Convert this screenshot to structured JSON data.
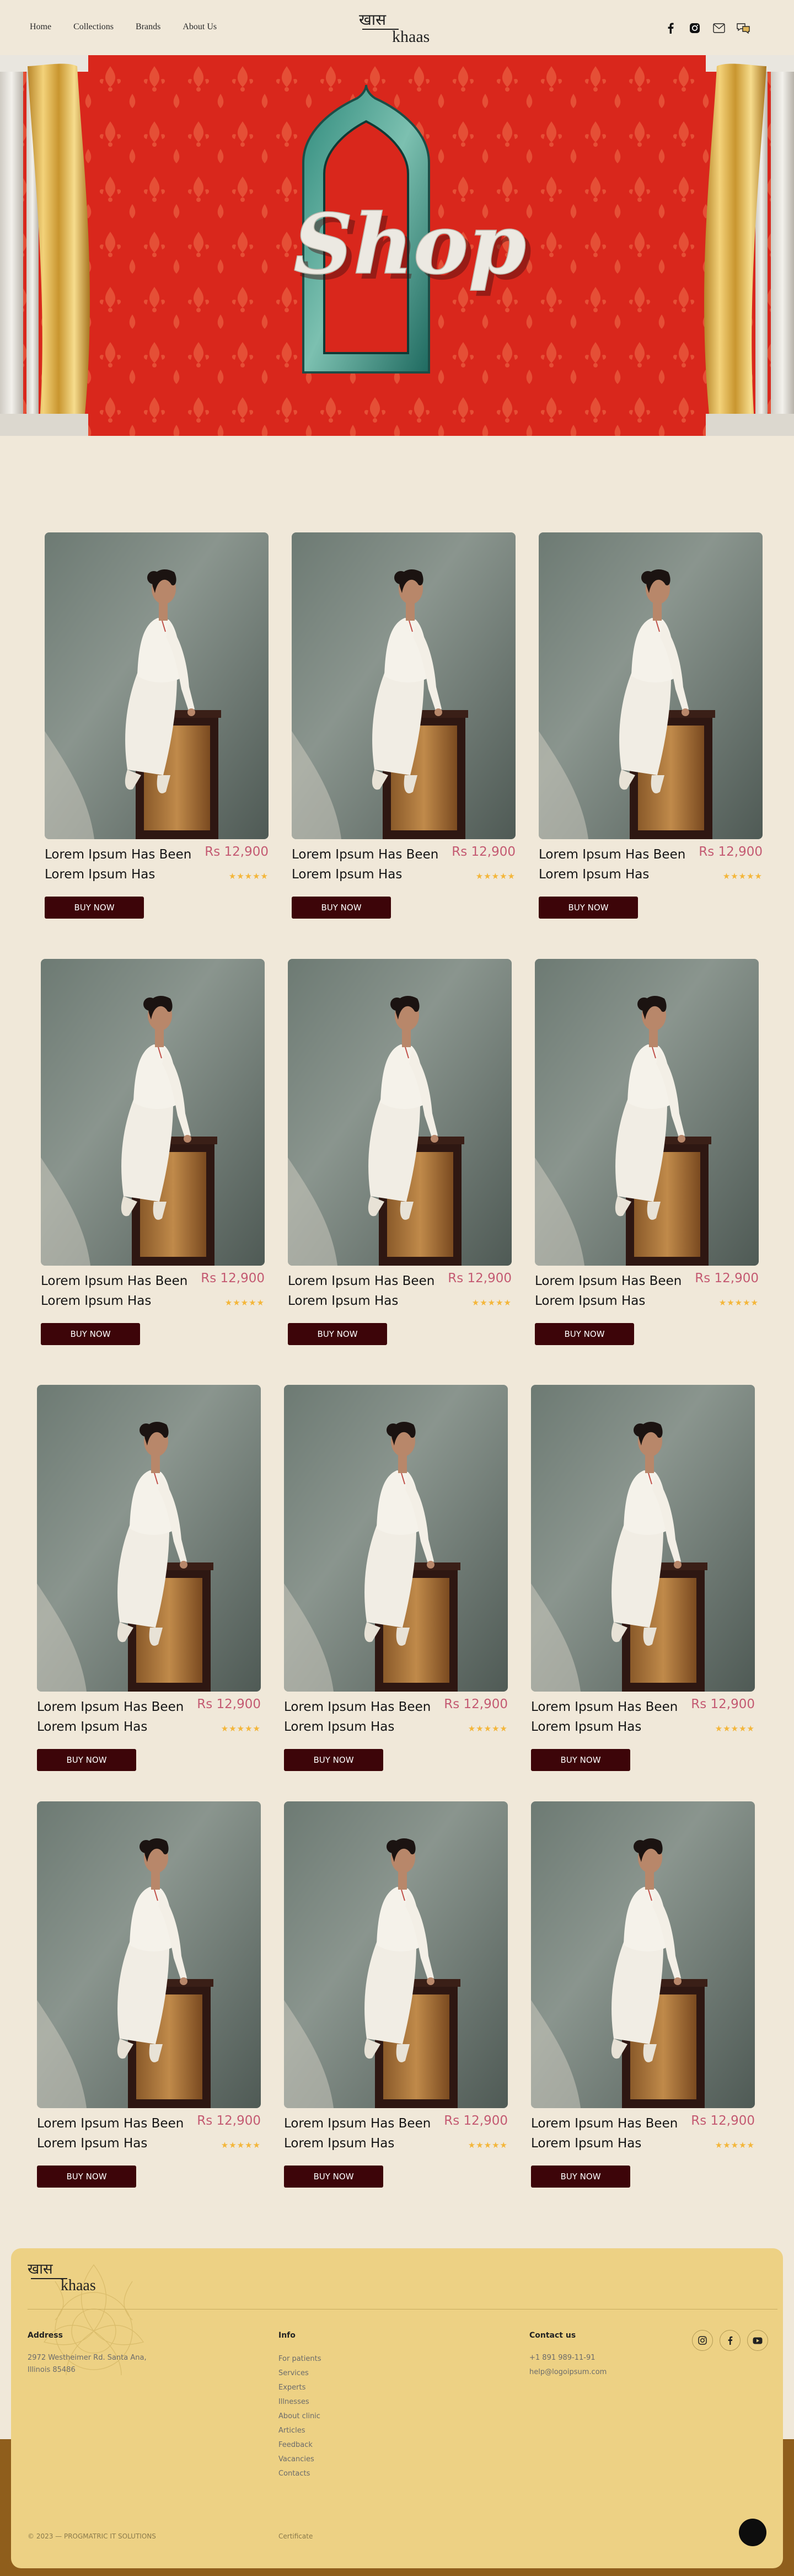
{
  "nav": {
    "links": [
      "Home",
      "Collections",
      "Brands",
      "About Us"
    ],
    "logo_hindi": "खास",
    "logo_en": "khaas",
    "icons": [
      "facebook-icon",
      "instagram-icon",
      "mail-icon",
      "chat-icon"
    ]
  },
  "hero": {
    "title": "Shop"
  },
  "products": [
    {
      "name": "Lorem Ipsum Has Been Lorem Ipsum Has",
      "price": "Rs 12,900",
      "rating": 5,
      "stars": "★★★★★",
      "button": "BUY NOW"
    },
    {
      "name": "Lorem Ipsum Has Been Lorem Ipsum Has",
      "price": "Rs 12,900",
      "rating": 5,
      "stars": "★★★★★",
      "button": "BUY NOW"
    },
    {
      "name": "Lorem Ipsum Has Been Lorem Ipsum Has",
      "price": "Rs 12,900",
      "rating": 5,
      "stars": "★★★★★",
      "button": "BUY NOW"
    },
    {
      "name": "Lorem Ipsum Has Been Lorem Ipsum Has",
      "price": "Rs 12,900",
      "rating": 5,
      "stars": "★★★★★",
      "button": "BUY NOW"
    },
    {
      "name": "Lorem Ipsum Has Been Lorem Ipsum Has",
      "price": "Rs 12,900",
      "rating": 5,
      "stars": "★★★★★",
      "button": "BUY NOW"
    },
    {
      "name": "Lorem Ipsum Has Been Lorem Ipsum Has",
      "price": "Rs 12,900",
      "rating": 5,
      "stars": "★★★★★",
      "button": "BUY NOW"
    },
    {
      "name": "Lorem Ipsum Has Been Lorem Ipsum Has",
      "price": "Rs 12,900",
      "rating": 5,
      "stars": "★★★★★",
      "button": "BUY NOW"
    },
    {
      "name": "Lorem Ipsum Has Been Lorem Ipsum Has",
      "price": "Rs 12,900",
      "rating": 5,
      "stars": "★★★★★",
      "button": "BUY NOW"
    },
    {
      "name": "Lorem Ipsum Has Been Lorem Ipsum Has",
      "price": "Rs 12,900",
      "rating": 5,
      "stars": "★★★★★",
      "button": "BUY NOW"
    },
    {
      "name": "Lorem Ipsum Has Been Lorem Ipsum Has",
      "price": "Rs 12,900",
      "rating": 5,
      "stars": "★★★★★",
      "button": "BUY NOW"
    },
    {
      "name": "Lorem Ipsum Has Been Lorem Ipsum Has",
      "price": "Rs 12,900",
      "rating": 5,
      "stars": "★★★★★",
      "button": "BUY NOW"
    },
    {
      "name": "Lorem Ipsum Has Been Lorem Ipsum Has",
      "price": "Rs 12,900",
      "rating": 5,
      "stars": "★★★★★",
      "button": "BUY NOW"
    }
  ],
  "footer": {
    "logo_hindi": "खास",
    "logo_en": "khaas",
    "address": {
      "heading": "Address",
      "text": "2972 Westheimer Rd. Santa Ana, Illinois 85486"
    },
    "info": {
      "heading": "Info",
      "links": [
        "For patients",
        "Services",
        "Experts",
        "Illnesses",
        "About clinic",
        "Articles",
        "Feedback",
        "Vacancies",
        "Contacts"
      ]
    },
    "contact": {
      "heading": "Contact us",
      "phone": "+1 891 989-11-91",
      "email": "help@logoipsum.com"
    },
    "social_icons": [
      "instagram-icon",
      "facebook-icon",
      "youtube-icon"
    ],
    "copyright": "© 2023 — PROGMATRIC IT SOLUTIONS",
    "certificate": "Certificate"
  },
  "colors": {
    "background": "#f0e8d9",
    "hero_red": "#d9261c",
    "price": "#c45a72",
    "button": "#3d0509",
    "stars": "#f4b63a",
    "footer": "#edd184",
    "footer_band": "#8f5e1c"
  }
}
